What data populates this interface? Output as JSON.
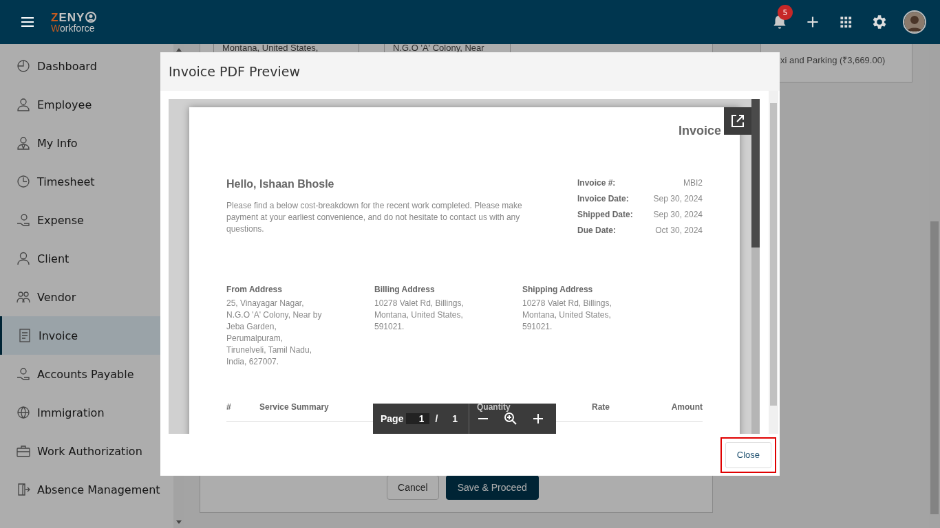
{
  "header": {
    "logo_top": "ZENY",
    "logo_bottom": "Workforce",
    "notification_count": "5"
  },
  "sidebar": {
    "items": [
      {
        "label": "Dashboard",
        "selected": false
      },
      {
        "label": "Employee",
        "selected": false
      },
      {
        "label": "My Info",
        "selected": false
      },
      {
        "label": "Timesheet",
        "selected": false
      },
      {
        "label": "Expense",
        "selected": false
      },
      {
        "label": "Client",
        "selected": false
      },
      {
        "label": "Vendor",
        "selected": false
      },
      {
        "label": "Invoice",
        "selected": true
      },
      {
        "label": "Accounts Payable",
        "selected": false
      },
      {
        "label": "Immigration",
        "selected": false
      },
      {
        "label": "Work Authorization",
        "selected": false
      },
      {
        "label": "Absence Management",
        "selected": false
      }
    ]
  },
  "background_form": {
    "fields": [
      "Montana, United States,",
      "N.G.O 'A' Colony, Near"
    ],
    "summary_card": "xi and Parking (₹3,669.00)",
    "buttons": [
      "Cancel",
      "Save & Proceed"
    ]
  },
  "modal": {
    "title": "Invoice PDF Preview",
    "document": {
      "title": "Invoice",
      "greeting": "Hello, Ishaan Bhosle",
      "message": "Please find a below cost-breakdown for the recent work completed. Please make payment at your earliest convenience, and do not hesitate to contact us with any questions.",
      "details": [
        {
          "label": "Invoice #:",
          "value": "MBI2"
        },
        {
          "label": "Invoice Date:",
          "value": "Sep 30, 2024"
        },
        {
          "label": "Shipped Date:",
          "value": "Sep 30, 2024"
        },
        {
          "label": "Due Date:",
          "value": "Oct 30, 2024"
        }
      ],
      "addresses": [
        {
          "heading": "From Address",
          "text": "25, Vinayagar Nagar,\nN.G.O 'A' Colony, Near by\nJeba Garden,\nPerumalpuram,\nTirunelveli, Tamil Nadu,\nIndia, 627007."
        },
        {
          "heading": "Billing Address",
          "text": "10278 Valet Rd, Billings,\nMontana, United States,\n591021."
        },
        {
          "heading": "Shipping Address",
          "text": "10278 Valet Rd, Billings,\nMontana, United States,\n591021."
        }
      ],
      "table_columns": [
        "#",
        "Service Summary",
        "Quantity",
        "Rate",
        "Amount"
      ]
    },
    "pdf_toolbar": {
      "page_label": "Page",
      "page_input": "1",
      "separator": "/",
      "page_count": "1"
    },
    "buttons": [
      "Close"
    ]
  }
}
